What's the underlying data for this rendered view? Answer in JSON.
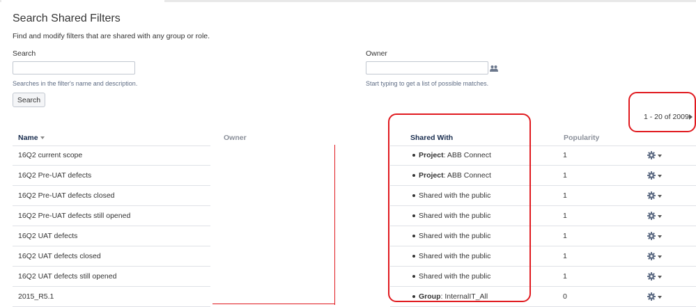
{
  "page": {
    "title": "Search Shared Filters",
    "description": "Find and modify filters that are shared with any group or role."
  },
  "search": {
    "label": "Search",
    "value": "",
    "hint": "Searches in the filter's name and description."
  },
  "owner": {
    "label": "Owner",
    "value": "",
    "hint": "Start typing to get a list of possible matches."
  },
  "search_button": "Search",
  "pagination": "1 - 20 of 2009",
  "table": {
    "headers": {
      "name": "Name",
      "owner": "Owner",
      "shared_with": "Shared With",
      "popularity": "Popularity"
    },
    "rows": [
      {
        "name": "16Q2 current scope",
        "owner": "",
        "shared_type": "Project",
        "shared_value": ": ABB Connect",
        "popularity": "1"
      },
      {
        "name": "16Q2 Pre-UAT defects",
        "owner": "",
        "shared_type": "Project",
        "shared_value": ": ABB Connect",
        "popularity": "1"
      },
      {
        "name": "16Q2 Pre-UAT defects closed",
        "owner": "",
        "shared_type": "",
        "shared_value": "Shared with the public",
        "popularity": "1"
      },
      {
        "name": "16Q2 Pre-UAT defects still opened",
        "owner": "",
        "shared_type": "",
        "shared_value": "Shared with the public",
        "popularity": "1"
      },
      {
        "name": "16Q2 UAT defects",
        "owner": "",
        "shared_type": "",
        "shared_value": "Shared with the public",
        "popularity": "1"
      },
      {
        "name": "16Q2 UAT defects closed",
        "owner": "",
        "shared_type": "",
        "shared_value": "Shared with the public",
        "popularity": "1"
      },
      {
        "name": "16Q2 UAT defects still opened",
        "owner": "",
        "shared_type": "",
        "shared_value": "Shared with the public",
        "popularity": "1"
      },
      {
        "name": "2015_R5.1",
        "owner": "",
        "shared_type": "Group",
        "shared_value": ": InternalIT_All",
        "popularity": "0"
      }
    ]
  },
  "icons": {
    "owner_picker": "users-icon",
    "row_actions": "gear-icon",
    "sort": "sort-arrow-icon",
    "next_page": "next-page-icon"
  },
  "colors": {
    "annotation_red": "#e0191e",
    "text": "#333333",
    "muted_header": "#8a8f99"
  }
}
